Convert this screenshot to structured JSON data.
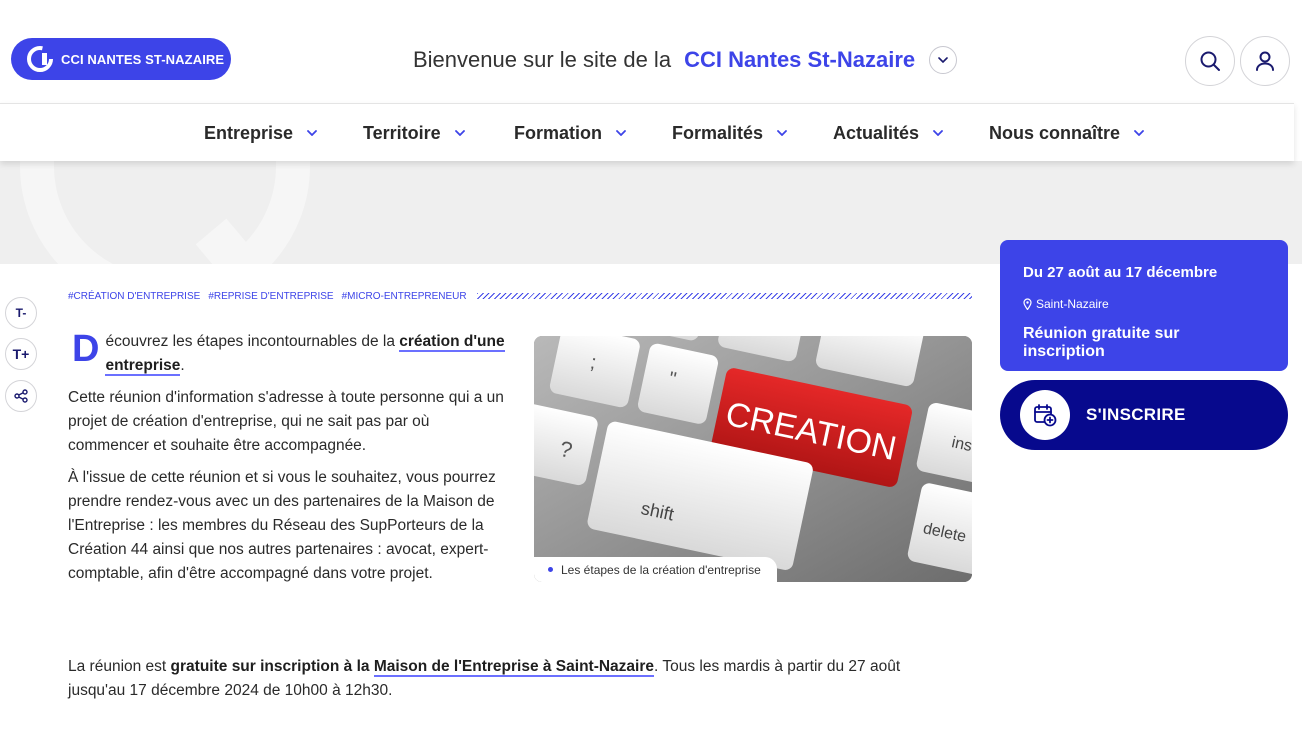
{
  "header": {
    "logo_text": "CCI NANTES ST-NAZAIRE",
    "welcome_prefix": "Bienvenue sur le site de la",
    "welcome_brand": "CCI Nantes St-Nazaire"
  },
  "nav": {
    "items": [
      {
        "label": "Entreprise"
      },
      {
        "label": "Territoire"
      },
      {
        "label": "Formation"
      },
      {
        "label": "Formalités"
      },
      {
        "label": "Actualités"
      },
      {
        "label": "Nous connaître"
      }
    ]
  },
  "tools": {
    "text_smaller": "T-",
    "text_larger": "T+"
  },
  "tags": [
    "#CRÉATION D'ENTREPRISE",
    "#REPRISE D'ENTREPRISE",
    "#MICRO-ENTREPRENEUR"
  ],
  "article": {
    "dropcap": "D",
    "intro_text": "écouvrez les étapes incontournables de la ",
    "intro_link": "création d'une entreprise",
    "intro_end": ".",
    "para2": "Cette réunion d'information s'adresse à toute personne qui a un projet de création d'entreprise, qui ne sait pas par où commencer et souhaite être accompagnée.",
    "para3": "À l'issue de cette réunion et si vous le souhaitez, vous pourrez prendre rendez-vous avec un des partenaires de la Maison de l'Entreprise : les membres du Réseau des SupPorteurs de la Création 44 ainsi que nos autres partenaires : avocat, expert-comptable, afin d'être accompagné dans votre projet.",
    "bottom_prefix": "La réunion est ",
    "bottom_bold": "gratuite sur inscription à la ",
    "bottom_link": "Maison de l'Entreprise à Saint-Nazaire",
    "bottom_suffix": ". Tous les mardis à partir du 27 août jusqu'au 17 décembre 2024 de 10h00 à 12h30."
  },
  "figure": {
    "key_label": "CREATION",
    "key_shift": "shift",
    "key_delete": "delete",
    "key_ins": "ins",
    "caption": "Les étapes de la création d'entreprise"
  },
  "event": {
    "dates": "Du 27 août au 17 décembre",
    "place": "Saint-Nazaire",
    "title": "Réunion gratuite sur inscription",
    "register_label": "S'INSCRIRE"
  },
  "colors": {
    "brand": "#3d44e8",
    "dark_brand": "#07098d",
    "key_red": "#d21f1f"
  },
  "icons": [
    "logo-mark-icon",
    "chevron-down-icon",
    "search-icon",
    "user-icon",
    "share-icon",
    "map-pin-icon",
    "calendar-add-icon"
  ]
}
